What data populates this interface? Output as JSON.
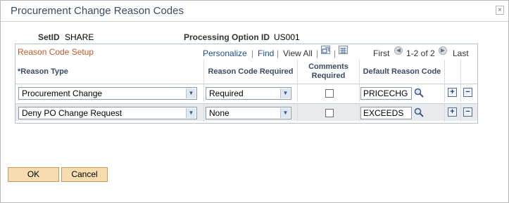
{
  "dialog": {
    "title": "Procurement Change Reason Codes",
    "close_glyph": "×"
  },
  "header": {
    "setid_label": "SetID",
    "setid_value": "SHARE",
    "option_label": "Processing Option ID",
    "option_value": "US001"
  },
  "grid": {
    "title": "Reason Code Setup",
    "nav": {
      "personalize": "Personalize",
      "find": "Find",
      "view_all": "View All",
      "first": "First",
      "range": "1-2 of 2",
      "last": "Last",
      "sep": "|"
    },
    "columns": {
      "reason_type": "*Reason Type",
      "reason_code_required": "Reason Code Required",
      "comments_required": "Comments Required",
      "default_reason_code": "Default Reason Code"
    },
    "rows": [
      {
        "reason_type": "Procurement Change",
        "code_required": "Required",
        "comments_required": false,
        "default_code": "PRICECHG"
      },
      {
        "reason_type": "Deny PO Change Request",
        "code_required": "None",
        "comments_required": false,
        "default_code": "EXCEEDS"
      }
    ],
    "add_glyph": "+",
    "delete_glyph": "−"
  },
  "buttons": {
    "ok": "OK",
    "cancel": "Cancel"
  },
  "colors": {
    "title": "#3a4b65",
    "grid_title": "#c05a2a",
    "link": "#1b4e8a",
    "button_bg": "#f6dcae"
  },
  "icons": [
    "close-icon",
    "zoom-icon",
    "download-icon",
    "prev-icon",
    "next-icon",
    "lookup-icon",
    "dropdown-icon"
  ]
}
